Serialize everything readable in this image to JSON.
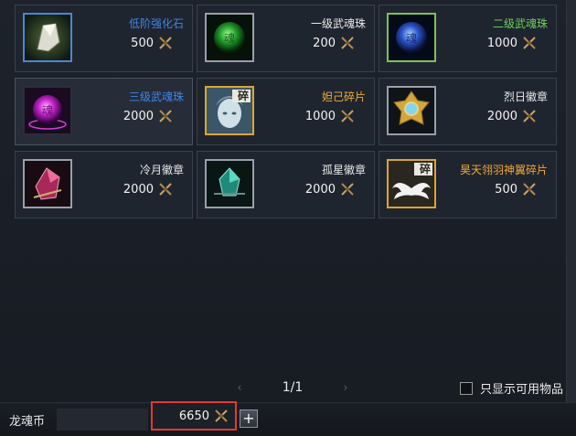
{
  "items": [
    {
      "name": "低阶强化石",
      "price": "500",
      "quality": "blue",
      "icon": "white-crystal-icon"
    },
    {
      "name": "一级武魂珠",
      "price": "200",
      "quality": "white",
      "icon": "green-soul-orb-icon"
    },
    {
      "name": "二级武魂珠",
      "price": "1000",
      "quality": "green",
      "icon": "blue-soul-orb-icon"
    },
    {
      "name": "三级武魂珠",
      "price": "2000",
      "quality": "blue",
      "icon": "purple-soul-orb-icon"
    },
    {
      "name": "妲己碎片",
      "price": "1000",
      "quality": "gold",
      "icon": "daji-portrait-fragment-icon",
      "badge": "碎"
    },
    {
      "name": "烈日徽章",
      "price": "2000",
      "quality": "white",
      "icon": "sun-emblem-icon"
    },
    {
      "name": "冷月徽章",
      "price": "2000",
      "quality": "white",
      "icon": "red-gem-badge-icon"
    },
    {
      "name": "孤星徽章",
      "price": "2000",
      "quality": "white",
      "icon": "green-gem-badge-icon"
    },
    {
      "name": "昊天翎羽神翼碎片",
      "price": "500",
      "quality": "gold",
      "icon": "wings-fragment-icon",
      "badge": "碎"
    }
  ],
  "pager": {
    "prev": "‹",
    "page": "1/1",
    "next": "›"
  },
  "filter": {
    "label": "只显示可用物品",
    "checked": false
  },
  "currency": {
    "label": "龙魂币",
    "balance": "6650",
    "add": "+",
    "icon": "crossed-swords-currency-icon"
  },
  "selected_index": 3
}
